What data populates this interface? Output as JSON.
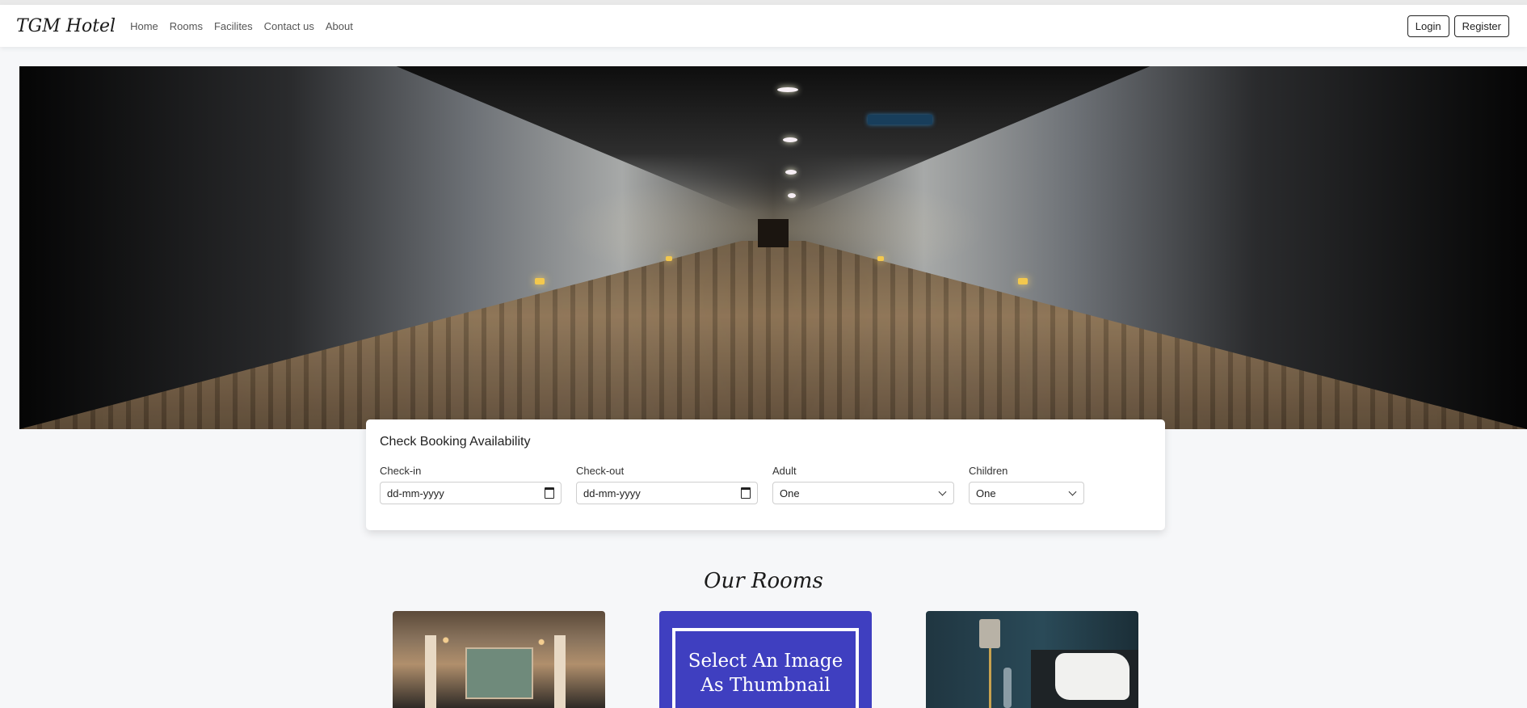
{
  "navbar": {
    "brand": "TGM Hotel",
    "links": [
      "Home",
      "Rooms",
      "Facilites",
      "Contact us",
      "About"
    ],
    "login_label": "Login",
    "register_label": "Register"
  },
  "hero": {
    "image_icon": "hotel-corridor-image"
  },
  "booking": {
    "title": "Check Booking Availability",
    "checkin_label": "Check-in",
    "checkin_value": "dd-mm-yyyy",
    "checkout_label": "Check-out",
    "checkout_value": "dd-mm-yyyy",
    "adult_label": "Adult",
    "adult_value": "One",
    "children_label": "Children",
    "children_value": "One"
  },
  "rooms": {
    "title": "Our Rooms",
    "thumb_placeholder_line1": "Select An Image",
    "thumb_placeholder_line2": "As Thumbnail"
  }
}
